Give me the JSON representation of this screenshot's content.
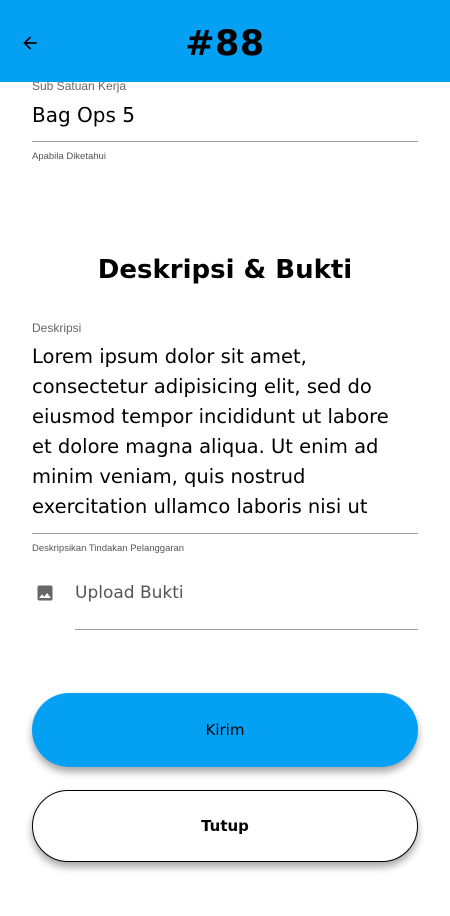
{
  "appbar": {
    "title": "#88",
    "back_icon": "arrow-back-icon",
    "color": "#03A0F4"
  },
  "sub_satuan_kerja": {
    "label": "Sub Satuan Kerja",
    "value": "Bag Ops 5",
    "helper": "Apabila Diketahui"
  },
  "section": {
    "title": "Deskripsi & Bukti"
  },
  "deskripsi": {
    "label": "Deskripsi",
    "value": "Lorem ipsum dolor sit amet, consectetur adipisicing elit, sed do eiusmod tempor incididunt ut labore et dolore magna aliqua. Ut enim ad minim veniam, quis nostrud exercitation ullamco laboris nisi ut",
    "helper": "Deskripsikan Tindakan Pelanggaran"
  },
  "upload": {
    "icon": "image-icon",
    "label": "Upload Bukti"
  },
  "buttons": {
    "submit": "Kirim",
    "close": "Tutup"
  }
}
